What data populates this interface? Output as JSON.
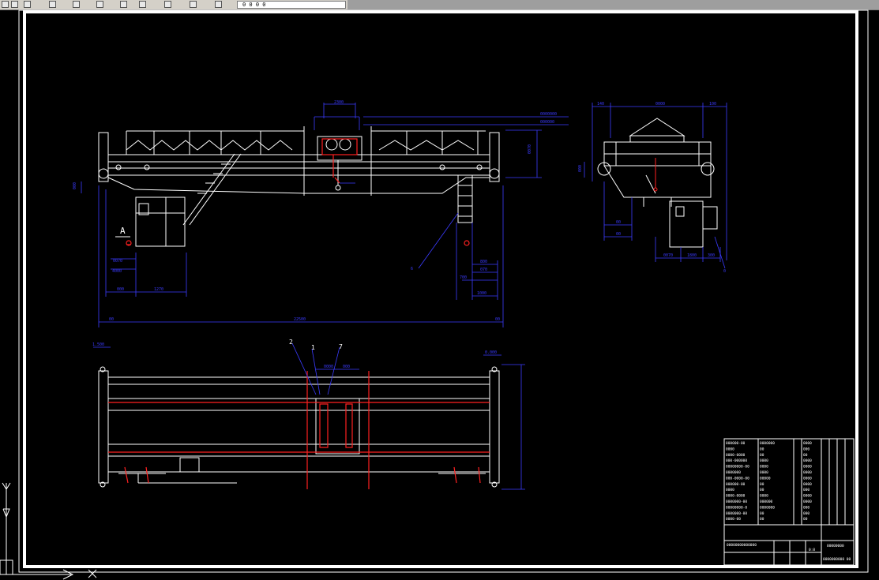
{
  "toolbar": {
    "layer_field": "0 0 0  0",
    "icons": [
      "layer-icon",
      "print-icon",
      "block-icon",
      "undo-icon",
      "redo-icon",
      "pan-icon",
      "zoom-icon",
      "properties-icon",
      "table-icon",
      "grid-icon",
      "snap-icon"
    ]
  },
  "drawing": {
    "front_view": {
      "dims_top": [
        "2300",
        "0000000",
        "000000"
      ],
      "dims_right": [
        "0070",
        "0000"
      ],
      "dim_left": "000",
      "section_label": "A",
      "leader_label": "6",
      "dims_lower_left": [
        "0070",
        "4000",
        "000",
        "1270"
      ],
      "dims_lower_right": [
        "800",
        "070",
        "700",
        "1000"
      ],
      "span_dim": "22500",
      "span_ends": [
        "00",
        "00"
      ]
    },
    "side_view": {
      "dims_top": [
        "140",
        "0000",
        "100"
      ],
      "dim_side": "000",
      "dims_bottom": [
        "00",
        "00",
        "0070",
        "1800",
        "300"
      ],
      "leader_label": "0"
    },
    "plan_view": {
      "elev_left": "1.500",
      "elev_right": "0.000",
      "callouts": [
        "2",
        "1",
        "7"
      ],
      "dims_top": [
        "0000",
        "000"
      ]
    },
    "title_block": {
      "rows_left": [
        "000000-00",
        "0000",
        "0000-0000",
        "000-000000",
        "00000000-00",
        "0000000",
        "000-0000-00",
        "000000-00",
        "0000",
        "0000-0000",
        "0000000-00",
        "00000000-0",
        "0000000-00",
        "0000-00"
      ],
      "rows_mid": [
        "0000000",
        "00",
        "00",
        "0000",
        "0000",
        "0000",
        "00000",
        "00",
        "00",
        "0000",
        "000000",
        "0000000",
        "00",
        "00"
      ],
      "rows_right": [
        "0000",
        "000",
        "00",
        "0000",
        "0000",
        "0000",
        "0000",
        "0000",
        "000",
        "0000",
        "0000",
        "000",
        "000",
        "00"
      ],
      "company": "00000000000000",
      "drawing_name": "00000000",
      "drawing_no": "0000000000 00",
      "scale_label": "0:0"
    }
  }
}
